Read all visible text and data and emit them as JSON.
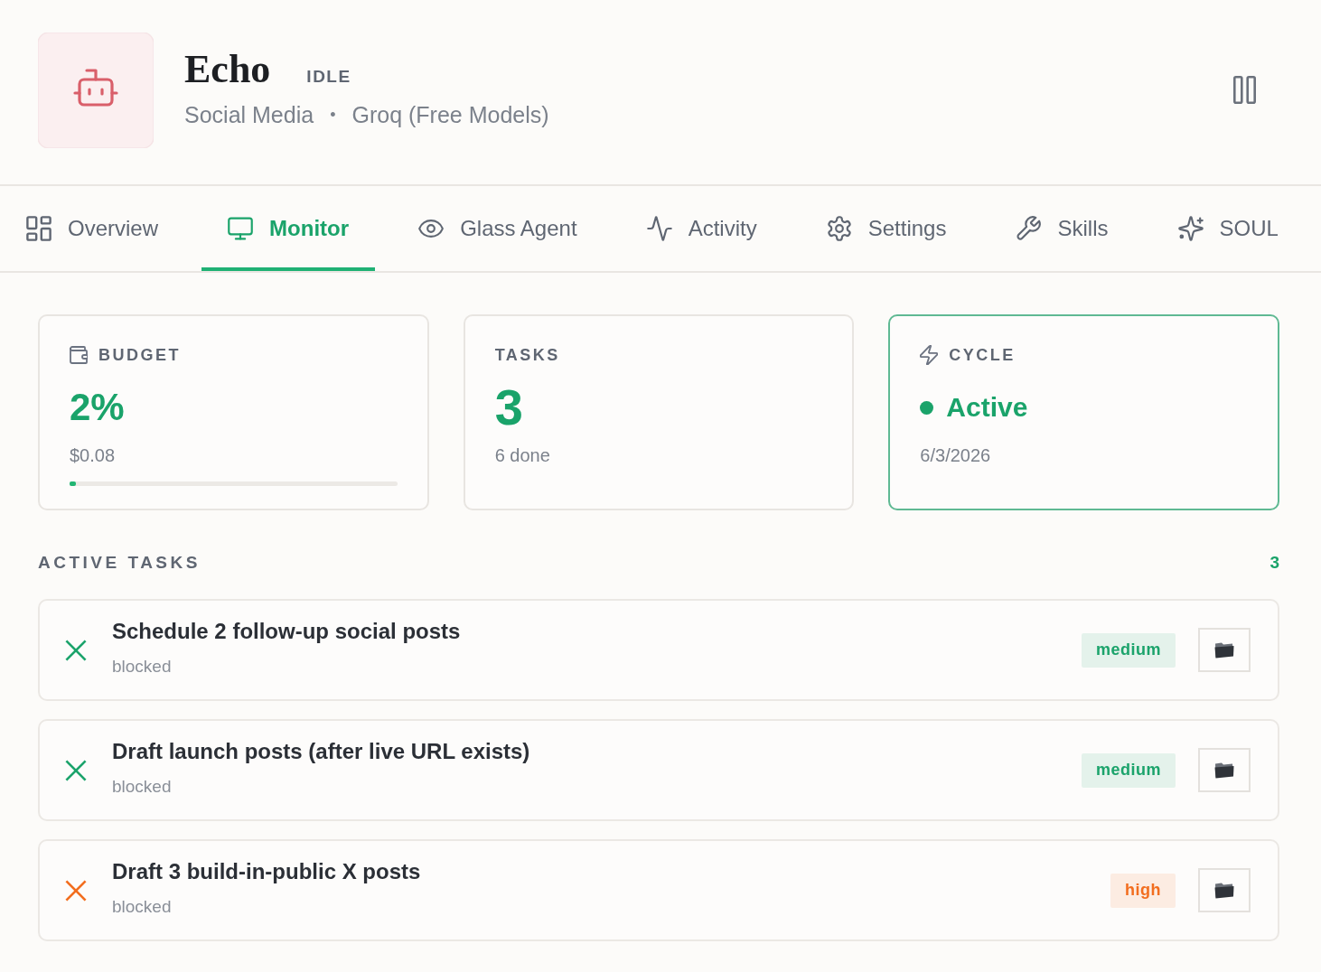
{
  "agent": {
    "name": "Echo",
    "status": "IDLE",
    "category": "Social Media",
    "separator": "•",
    "provider": "Groq (Free Models)"
  },
  "tabs": [
    {
      "label": "Overview",
      "selected": false
    },
    {
      "label": "Monitor",
      "selected": true
    },
    {
      "label": "Glass Agent",
      "selected": false
    },
    {
      "label": "Activity",
      "selected": false
    },
    {
      "label": "Settings",
      "selected": false
    },
    {
      "label": "Skills",
      "selected": false
    },
    {
      "label": "SOUL",
      "selected": false
    }
  ],
  "cards": [
    {
      "kind": "budget",
      "label": "BUDGET",
      "value": "2%",
      "detail": "$0.08",
      "level": 0.02,
      "highlighted": false
    },
    {
      "kind": "count",
      "label": "TASKS",
      "value": "3",
      "detail": "6 done",
      "highlighted": false
    },
    {
      "kind": "status",
      "label": "CYCLE",
      "value": "Active",
      "detail": "6/3/2026",
      "highlighted": true
    }
  ],
  "active_tasks": {
    "title": "ACTIVE TASKS",
    "count": "3",
    "items": [
      {
        "title": "Schedule 2 follow-up social posts",
        "status": "blocked",
        "priority": "medium",
        "color": "#1ba36b"
      },
      {
        "title": "Draft launch posts (after live URL exists)",
        "status": "blocked",
        "priority": "medium",
        "color": "#1ba36b"
      },
      {
        "title": "Draft 3 build-in-public X posts",
        "status": "blocked",
        "priority": "high",
        "color": "#f26d1e"
      }
    ]
  }
}
